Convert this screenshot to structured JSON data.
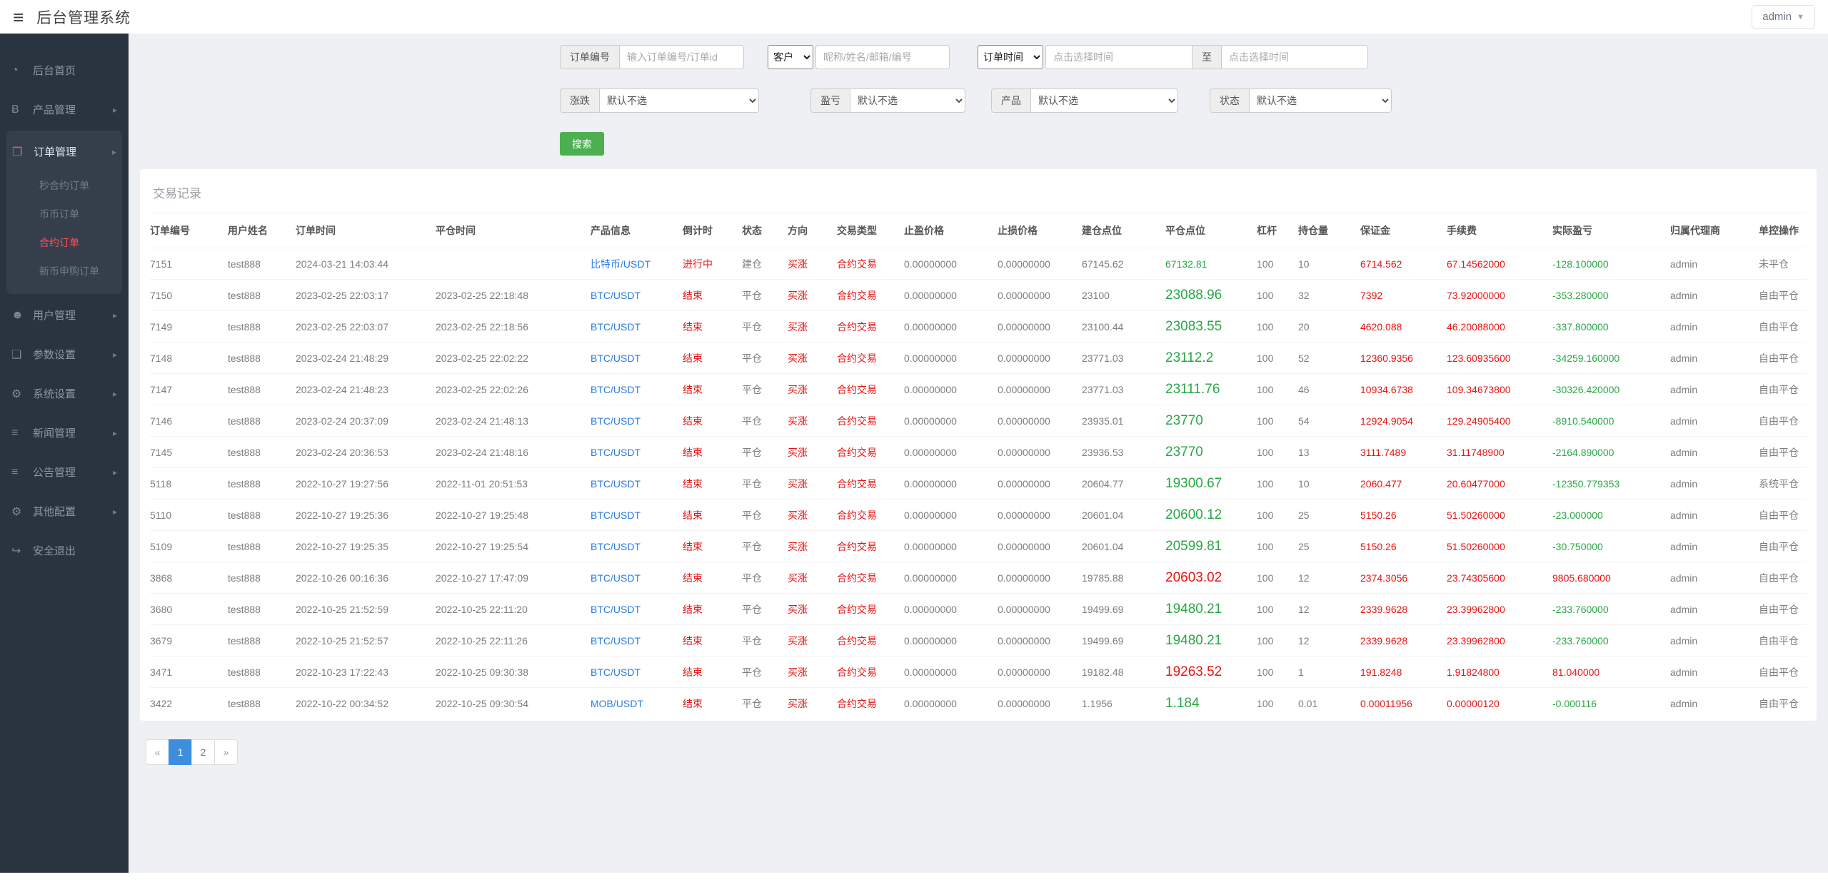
{
  "topbar": {
    "title": "后台管理系统",
    "user_label": "admin"
  },
  "colors": {
    "accent_red": "#e81414",
    "green": "#28a745",
    "link_blue": "#2b7ce0",
    "pagination_active": "#3d8fdd",
    "search_green": "#4caf50",
    "sidebar_active_red": "#ff5252"
  },
  "sidebar": {
    "items": [
      {
        "key": "home",
        "label": "后台首页",
        "icon": "dashboard-icon"
      },
      {
        "key": "products",
        "label": "产品管理",
        "icon": "bitcoin-icon",
        "arrow": true
      },
      {
        "key": "orders",
        "label": "订单管理",
        "icon": "orders-icon",
        "arrow": true,
        "open": true,
        "children": [
          {
            "key": "seconds-contract-orders",
            "label": "秒合约订单"
          },
          {
            "key": "spot-orders",
            "label": "币币订单"
          },
          {
            "key": "contract-orders",
            "label": "合约订单",
            "active": true
          },
          {
            "key": "new-coin-orders",
            "label": "新币申购订单"
          }
        ]
      },
      {
        "key": "users",
        "label": "用户管理",
        "icon": "user-icon",
        "arrow": true
      },
      {
        "key": "params",
        "label": "参数设置",
        "icon": "file-icon",
        "arrow": true
      },
      {
        "key": "system",
        "label": "系统设置",
        "icon": "gears-icon",
        "arrow": true
      },
      {
        "key": "news",
        "label": "新闻管理",
        "icon": "list-icon",
        "arrow": true
      },
      {
        "key": "notices",
        "label": "公告管理",
        "icon": "list-icon",
        "arrow": true
      },
      {
        "key": "other",
        "label": "其他配置",
        "icon": "gear-icon",
        "arrow": true
      },
      {
        "key": "logout",
        "label": "安全退出",
        "icon": "logout-icon"
      }
    ]
  },
  "filters": {
    "order_no_label": "订单编号",
    "order_no_placeholder": "输入订单编号/订单id",
    "customer_select": "客户",
    "customer_placeholder": "昵称/姓名/邮箱/编号",
    "time_select": "订单时间",
    "time_from_placeholder": "点击选择时间",
    "to_label": "至",
    "time_to_placeholder": "点击选择时间",
    "updown_label": "涨跌",
    "pnl_label": "盈亏",
    "product_label": "产品",
    "status_label": "状态",
    "default_option": "默认不选",
    "search_button": "搜索"
  },
  "table": {
    "title": "交易记录",
    "columns": [
      "订单编号",
      "用户姓名",
      "订单时间",
      "平仓时间",
      "产品信息",
      "倒计时",
      "状态",
      "方向",
      "交易类型",
      "止盈价格",
      "止损价格",
      "建仓点位",
      "平仓点位",
      "杠杆",
      "持仓量",
      "保证金",
      "手续费",
      "实际盈亏",
      "归属代理商",
      "单控操作"
    ],
    "rows": [
      {
        "id": "7151",
        "user": "test888",
        "open_time": "2024-03-21 14:03:44",
        "close_time": "",
        "product": "比特币/USDT",
        "countdown": "进行中",
        "status": "建仓",
        "direction": "买涨",
        "type": "合约交易",
        "tp": "0.00000000",
        "sl": "0.00000000",
        "open_price": "67145.62",
        "close_price": "67132.81",
        "close_color": "green",
        "close_size": "small",
        "lever": "100",
        "amount": "10",
        "margin": "6714.562",
        "fee": "67.14562000",
        "pnl": "-128.100000",
        "pnl_color": "green",
        "agent": "admin",
        "control": "未平仓"
      },
      {
        "id": "7150",
        "user": "test888",
        "open_time": "2023-02-25 22:03:17",
        "close_time": "2023-02-25 22:18:48",
        "product": "BTC/USDT",
        "countdown": "结束",
        "status": "平仓",
        "direction": "买涨",
        "type": "合约交易",
        "tp": "0.00000000",
        "sl": "0.00000000",
        "open_price": "23100",
        "close_price": "23088.96",
        "close_color": "green",
        "close_size": "large",
        "lever": "100",
        "amount": "32",
        "margin": "7392",
        "fee": "73.92000000",
        "pnl": "-353.280000",
        "pnl_color": "green",
        "agent": "admin",
        "control": "自由平仓"
      },
      {
        "id": "7149",
        "user": "test888",
        "open_time": "2023-02-25 22:03:07",
        "close_time": "2023-02-25 22:18:56",
        "product": "BTC/USDT",
        "countdown": "结束",
        "status": "平仓",
        "direction": "买涨",
        "type": "合约交易",
        "tp": "0.00000000",
        "sl": "0.00000000",
        "open_price": "23100.44",
        "close_price": "23083.55",
        "close_color": "green",
        "close_size": "large",
        "lever": "100",
        "amount": "20",
        "margin": "4620.088",
        "fee": "46.20088000",
        "pnl": "-337.800000",
        "pnl_color": "green",
        "agent": "admin",
        "control": "自由平仓"
      },
      {
        "id": "7148",
        "user": "test888",
        "open_time": "2023-02-24 21:48:29",
        "close_time": "2023-02-25 22:02:22",
        "product": "BTC/USDT",
        "countdown": "结束",
        "status": "平仓",
        "direction": "买涨",
        "type": "合约交易",
        "tp": "0.00000000",
        "sl": "0.00000000",
        "open_price": "23771.03",
        "close_price": "23112.2",
        "close_color": "green",
        "close_size": "large",
        "lever": "100",
        "amount": "52",
        "margin": "12360.9356",
        "fee": "123.60935600",
        "pnl": "-34259.160000",
        "pnl_color": "green",
        "agent": "admin",
        "control": "自由平仓"
      },
      {
        "id": "7147",
        "user": "test888",
        "open_time": "2023-02-24 21:48:23",
        "close_time": "2023-02-25 22:02:26",
        "product": "BTC/USDT",
        "countdown": "结束",
        "status": "平仓",
        "direction": "买涨",
        "type": "合约交易",
        "tp": "0.00000000",
        "sl": "0.00000000",
        "open_price": "23771.03",
        "close_price": "23111.76",
        "close_color": "green",
        "close_size": "large",
        "lever": "100",
        "amount": "46",
        "margin": "10934.6738",
        "fee": "109.34673800",
        "pnl": "-30326.420000",
        "pnl_color": "green",
        "agent": "admin",
        "control": "自由平仓"
      },
      {
        "id": "7146",
        "user": "test888",
        "open_time": "2023-02-24 20:37:09",
        "close_time": "2023-02-24 21:48:13",
        "product": "BTC/USDT",
        "countdown": "结束",
        "status": "平仓",
        "direction": "买涨",
        "type": "合约交易",
        "tp": "0.00000000",
        "sl": "0.00000000",
        "open_price": "23935.01",
        "close_price": "23770",
        "close_color": "green",
        "close_size": "large",
        "lever": "100",
        "amount": "54",
        "margin": "12924.9054",
        "fee": "129.24905400",
        "pnl": "-8910.540000",
        "pnl_color": "green",
        "agent": "admin",
        "control": "自由平仓"
      },
      {
        "id": "7145",
        "user": "test888",
        "open_time": "2023-02-24 20:36:53",
        "close_time": "2023-02-24 21:48:16",
        "product": "BTC/USDT",
        "countdown": "结束",
        "status": "平仓",
        "direction": "买涨",
        "type": "合约交易",
        "tp": "0.00000000",
        "sl": "0.00000000",
        "open_price": "23936.53",
        "close_price": "23770",
        "close_color": "green",
        "close_size": "large",
        "lever": "100",
        "amount": "13",
        "margin": "3111.7489",
        "fee": "31.11748900",
        "pnl": "-2164.890000",
        "pnl_color": "green",
        "agent": "admin",
        "control": "自由平仓"
      },
      {
        "id": "5118",
        "user": "test888",
        "open_time": "2022-10-27 19:27:56",
        "close_time": "2022-11-01 20:51:53",
        "product": "BTC/USDT",
        "countdown": "结束",
        "status": "平仓",
        "direction": "买涨",
        "type": "合约交易",
        "tp": "0.00000000",
        "sl": "0.00000000",
        "open_price": "20604.77",
        "close_price": "19300.67",
        "close_color": "green",
        "close_size": "large",
        "lever": "100",
        "amount": "10",
        "margin": "2060.477",
        "fee": "20.60477000",
        "pnl": "-12350.779353",
        "pnl_color": "green",
        "agent": "admin",
        "control": "系统平仓"
      },
      {
        "id": "5110",
        "user": "test888",
        "open_time": "2022-10-27 19:25:36",
        "close_time": "2022-10-27 19:25:48",
        "product": "BTC/USDT",
        "countdown": "结束",
        "status": "平仓",
        "direction": "买涨",
        "type": "合约交易",
        "tp": "0.00000000",
        "sl": "0.00000000",
        "open_price": "20601.04",
        "close_price": "20600.12",
        "close_color": "green",
        "close_size": "large",
        "lever": "100",
        "amount": "25",
        "margin": "5150.26",
        "fee": "51.50260000",
        "pnl": "-23.000000",
        "pnl_color": "green",
        "agent": "admin",
        "control": "自由平仓"
      },
      {
        "id": "5109",
        "user": "test888",
        "open_time": "2022-10-27 19:25:35",
        "close_time": "2022-10-27 19:25:54",
        "product": "BTC/USDT",
        "countdown": "结束",
        "status": "平仓",
        "direction": "买涨",
        "type": "合约交易",
        "tp": "0.00000000",
        "sl": "0.00000000",
        "open_price": "20601.04",
        "close_price": "20599.81",
        "close_color": "green",
        "close_size": "large",
        "lever": "100",
        "amount": "25",
        "margin": "5150.26",
        "fee": "51.50260000",
        "pnl": "-30.750000",
        "pnl_color": "green",
        "agent": "admin",
        "control": "自由平仓"
      },
      {
        "id": "3868",
        "user": "test888",
        "open_time": "2022-10-26 00:16:36",
        "close_time": "2022-10-27 17:47:09",
        "product": "BTC/USDT",
        "countdown": "结束",
        "status": "平仓",
        "direction": "买涨",
        "type": "合约交易",
        "tp": "0.00000000",
        "sl": "0.00000000",
        "open_price": "19785.88",
        "close_price": "20603.02",
        "close_color": "red",
        "close_size": "large",
        "lever": "100",
        "amount": "12",
        "margin": "2374.3056",
        "fee": "23.74305600",
        "pnl": "9805.680000",
        "pnl_color": "red",
        "agent": "admin",
        "control": "自由平仓"
      },
      {
        "id": "3680",
        "user": "test888",
        "open_time": "2022-10-25 21:52:59",
        "close_time": "2022-10-25 22:11:20",
        "product": "BTC/USDT",
        "countdown": "结束",
        "status": "平仓",
        "direction": "买涨",
        "type": "合约交易",
        "tp": "0.00000000",
        "sl": "0.00000000",
        "open_price": "19499.69",
        "close_price": "19480.21",
        "close_color": "green",
        "close_size": "large",
        "lever": "100",
        "amount": "12",
        "margin": "2339.9628",
        "fee": "23.39962800",
        "pnl": "-233.760000",
        "pnl_color": "green",
        "agent": "admin",
        "control": "自由平仓"
      },
      {
        "id": "3679",
        "user": "test888",
        "open_time": "2022-10-25 21:52:57",
        "close_time": "2022-10-25 22:11:26",
        "product": "BTC/USDT",
        "countdown": "结束",
        "status": "平仓",
        "direction": "买涨",
        "type": "合约交易",
        "tp": "0.00000000",
        "sl": "0.00000000",
        "open_price": "19499.69",
        "close_price": "19480.21",
        "close_color": "green",
        "close_size": "large",
        "lever": "100",
        "amount": "12",
        "margin": "2339.9628",
        "fee": "23.39962800",
        "pnl": "-233.760000",
        "pnl_color": "green",
        "agent": "admin",
        "control": "自由平仓"
      },
      {
        "id": "3471",
        "user": "test888",
        "open_time": "2022-10-23 17:22:43",
        "close_time": "2022-10-25 09:30:38",
        "product": "BTC/USDT",
        "countdown": "结束",
        "status": "平仓",
        "direction": "买涨",
        "type": "合约交易",
        "tp": "0.00000000",
        "sl": "0.00000000",
        "open_price": "19182.48",
        "close_price": "19263.52",
        "close_color": "red",
        "close_size": "large",
        "lever": "100",
        "amount": "1",
        "margin": "191.8248",
        "fee": "1.91824800",
        "pnl": "81.040000",
        "pnl_color": "red",
        "agent": "admin",
        "control": "自由平仓"
      },
      {
        "id": "3422",
        "user": "test888",
        "open_time": "2022-10-22 00:34:52",
        "close_time": "2022-10-25 09:30:54",
        "product": "MOB/USDT",
        "countdown": "结束",
        "status": "平仓",
        "direction": "买涨",
        "type": "合约交易",
        "tp": "0.00000000",
        "sl": "0.00000000",
        "open_price": "1.1956",
        "close_price": "1.184",
        "close_color": "green",
        "close_size": "large",
        "lever": "100",
        "amount": "0.01",
        "margin": "0.00011956",
        "fee": "0.00000120",
        "pnl": "-0.000116",
        "pnl_color": "green",
        "agent": "admin",
        "control": "自由平仓"
      }
    ]
  },
  "pagination": {
    "prev": "«",
    "pages": [
      "1",
      "2"
    ],
    "active": "1",
    "next": "»"
  }
}
